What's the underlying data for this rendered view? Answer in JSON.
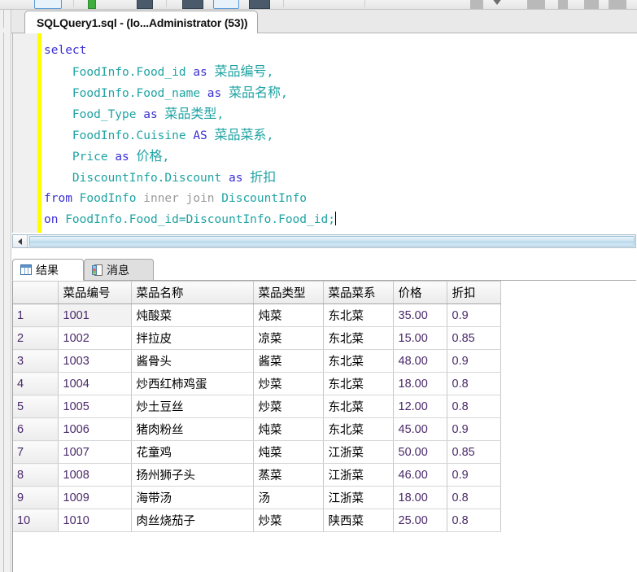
{
  "toolbar": {
    "items": [
      {
        "name": "new-query-button",
        "type": "box"
      },
      {
        "name": "execute-button",
        "type": "green"
      },
      {
        "name": "parse-button",
        "type": "dark"
      },
      {
        "name": "debug-button",
        "type": "dark"
      },
      {
        "name": "stop-button",
        "type": "box"
      },
      {
        "name": "plan-button",
        "type": "dark"
      },
      {
        "name": "results-grid-button",
        "type": "grey"
      },
      {
        "name": "results-text-button",
        "type": "grey"
      },
      {
        "name": "results-file-button",
        "type": "grey"
      },
      {
        "name": "comment-button",
        "type": "grey"
      }
    ],
    "overflow_label": "▼"
  },
  "document_tab": {
    "title": "SQLQuery1.sql - (lo...Administrator (53))"
  },
  "editor": {
    "lines": [
      [
        {
          "t": "select",
          "c": "kw"
        }
      ],
      [
        {
          "t": "    FoodInfo.Food_id ",
          "c": "id"
        },
        {
          "t": "as ",
          "c": "kw"
        },
        {
          "t": "菜品编号",
          "c": "cn"
        },
        {
          "t": ",",
          "c": "id"
        }
      ],
      [
        {
          "t": "    FoodInfo.Food_name ",
          "c": "id"
        },
        {
          "t": "as ",
          "c": "kw"
        },
        {
          "t": "菜品名称",
          "c": "cn"
        },
        {
          "t": ",",
          "c": "id"
        }
      ],
      [
        {
          "t": "    Food_Type ",
          "c": "id"
        },
        {
          "t": "as ",
          "c": "kw"
        },
        {
          "t": "菜品类型",
          "c": "cn"
        },
        {
          "t": ",",
          "c": "id"
        }
      ],
      [
        {
          "t": "    FoodInfo.Cuisine ",
          "c": "id"
        },
        {
          "t": "AS ",
          "c": "kw"
        },
        {
          "t": "菜品菜系",
          "c": "cn"
        },
        {
          "t": ",",
          "c": "id"
        }
      ],
      [
        {
          "t": "    Price ",
          "c": "id"
        },
        {
          "t": "as ",
          "c": "kw"
        },
        {
          "t": "价格",
          "c": "cn"
        },
        {
          "t": ",",
          "c": "id"
        }
      ],
      [
        {
          "t": "    DiscountInfo.Discount ",
          "c": "id"
        },
        {
          "t": "as ",
          "c": "kw"
        },
        {
          "t": "折扣",
          "c": "cn"
        }
      ],
      [
        {
          "t": "from ",
          "c": "kw"
        },
        {
          "t": "FoodInfo ",
          "c": "id"
        },
        {
          "t": "inner join ",
          "c": "plain"
        },
        {
          "t": "DiscountInfo",
          "c": "id"
        }
      ],
      [
        {
          "t": "on ",
          "c": "kw"
        },
        {
          "t": "FoodInfo.Food_id=DiscountInfo.Food_id;",
          "c": "id"
        }
      ]
    ]
  },
  "results_panel": {
    "tabs": [
      {
        "label": "结果",
        "icon": "grid-icon",
        "active": true
      },
      {
        "label": "消息",
        "icon": "message-icon",
        "active": false
      }
    ]
  },
  "grid": {
    "columns": [
      "菜品编号",
      "菜品名称",
      "菜品类型",
      "菜品菜系",
      "价格",
      "折扣"
    ],
    "rows": [
      {
        "n": "1",
        "cells": [
          "1001",
          "炖酸菜",
          "炖菜",
          "东北菜",
          "35.00",
          "0.9"
        ]
      },
      {
        "n": "2",
        "cells": [
          "1002",
          "拌拉皮",
          "凉菜",
          "东北菜",
          "15.00",
          "0.85"
        ]
      },
      {
        "n": "3",
        "cells": [
          "1003",
          "酱骨头",
          "酱菜",
          "东北菜",
          "48.00",
          "0.9"
        ]
      },
      {
        "n": "4",
        "cells": [
          "1004",
          "炒西红柿鸡蛋",
          "炒菜",
          "东北菜",
          "18.00",
          "0.8"
        ]
      },
      {
        "n": "5",
        "cells": [
          "1005",
          "炒土豆丝",
          "炒菜",
          "东北菜",
          "12.00",
          "0.8"
        ]
      },
      {
        "n": "6",
        "cells": [
          "1006",
          "猪肉粉丝",
          "炖菜",
          "东北菜",
          "45.00",
          "0.9"
        ]
      },
      {
        "n": "7",
        "cells": [
          "1007",
          "花童鸡",
          "炖菜",
          "江浙菜",
          "50.00",
          "0.85"
        ]
      },
      {
        "n": "8",
        "cells": [
          "1008",
          "扬州狮子头",
          "蒸菜",
          "江浙菜",
          "46.00",
          "0.9"
        ]
      },
      {
        "n": "9",
        "cells": [
          "1009",
          "海带汤",
          "汤",
          "江浙菜",
          "18.00",
          "0.8"
        ]
      },
      {
        "n": "10",
        "cells": [
          "1010",
          "肉丝烧茄子",
          "炒菜",
          "陕西菜",
          "25.00",
          "0.8"
        ]
      }
    ],
    "selected_cell": {
      "row": 0,
      "col": 0
    }
  }
}
